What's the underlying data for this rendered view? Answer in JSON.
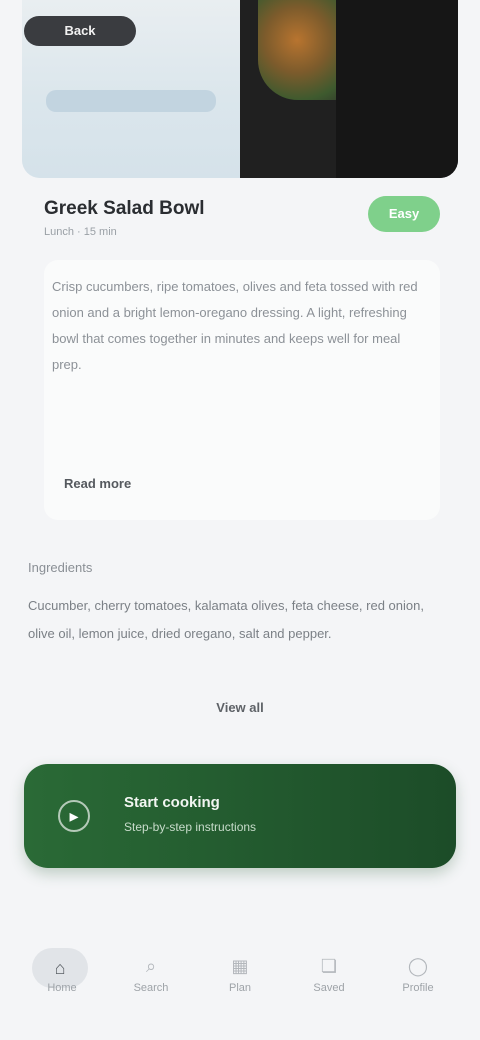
{
  "header": {
    "back_label": "Back"
  },
  "recipe": {
    "title": "Greek Salad Bowl",
    "meta": "Lunch · 15 min",
    "status_label": "Easy"
  },
  "description": {
    "text": "Crisp cucumbers, ripe tomatoes, olives and feta tossed with red onion and a bright lemon-oregano dressing. A light, refreshing bowl that comes together in minutes and keeps well for meal prep.",
    "link_label": "Read more"
  },
  "ingredients_section": {
    "label": "Ingredients",
    "text": "Cucumber, cherry tomatoes, kalamata olives, feta cheese, red onion, olive oil, lemon juice, dried oregano, salt and pepper.",
    "view_all_label": "View all"
  },
  "cta": {
    "title": "Start cooking",
    "subtitle": "Step-by-step instructions"
  },
  "bottom_nav": {
    "items": [
      {
        "label": "Home",
        "icon": "home-icon"
      },
      {
        "label": "Search",
        "icon": "search-icon"
      },
      {
        "label": "Plan",
        "icon": "calendar-icon"
      },
      {
        "label": "Saved",
        "icon": "bookmark-icon"
      },
      {
        "label": "Profile",
        "icon": "user-icon"
      }
    ]
  },
  "colors": {
    "accent_green": "#1f5a2b",
    "status_green": "#7fd08b",
    "background": "#f4f5f7"
  }
}
